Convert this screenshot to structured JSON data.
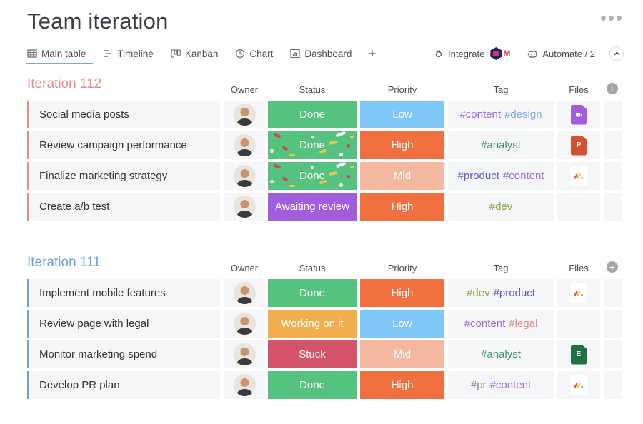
{
  "header": {
    "title": "Team iteration",
    "more_icon": "more-horizontal-icon"
  },
  "tabs": [
    {
      "label": "Main table",
      "icon": "table-icon",
      "active": true
    },
    {
      "label": "Timeline",
      "icon": "timeline-icon",
      "active": false
    },
    {
      "label": "Kanban",
      "icon": "kanban-icon",
      "active": false
    },
    {
      "label": "Chart",
      "icon": "chart-icon",
      "active": false
    },
    {
      "label": "Dashboard",
      "icon": "dashboard-icon",
      "active": false
    }
  ],
  "add_tab_label": "+",
  "toolbar": {
    "integrate_label": "Integrate",
    "automate_label": "Automate / 2",
    "collapse_icon": "chevron-up-icon"
  },
  "columns": {
    "owner": "Owner",
    "status": "Status",
    "priority": "Priority",
    "tag": "Tag",
    "files": "Files"
  },
  "colors": {
    "done": "#55c27f",
    "working": "#f2ad4e",
    "stuck": "#d5546a",
    "awaiting": "#a25ddc",
    "low": "#7ec8f8",
    "high": "#f0703f",
    "mid": "#f4b8a0",
    "group_112": "#e48a8a",
    "group_111": "#6fa0de",
    "tag_content": "#9b6ad6",
    "tag_design": "#7fa9e6",
    "tag_analyst": "#3f8f6a",
    "tag_product": "#5a5bc6",
    "tag_dev": "#8fa53c",
    "tag_legal": "#e38c8c",
    "tag_pr": "#8a8a94"
  },
  "groups": [
    {
      "title": "Iteration 112",
      "color": "#e48a8a",
      "rows": [
        {
          "name": "Social media posts",
          "status": "Done",
          "status_key": "done",
          "confetti": false,
          "priority": "Low",
          "priority_key": "low",
          "tags": [
            {
              "text": "#content",
              "key": "tag_content"
            },
            {
              "text": "#design",
              "key": "tag_design"
            }
          ],
          "file": "video-file"
        },
        {
          "name": "Review campaign performance",
          "status": "Done",
          "status_key": "done",
          "confetti": true,
          "priority": "High",
          "priority_key": "high",
          "tags": [
            {
              "text": "#analyst",
              "key": "tag_analyst"
            }
          ],
          "file": "powerpoint-file"
        },
        {
          "name": "Finalize marketing strategy",
          "status": "Done",
          "status_key": "done",
          "confetti": true,
          "priority": "Mid",
          "priority_key": "mid",
          "tags": [
            {
              "text": "#product",
              "key": "tag_product"
            },
            {
              "text": "#content",
              "key": "tag_content"
            }
          ],
          "file": "monday-file"
        },
        {
          "name": "Create a/b test",
          "status": "Awaiting review",
          "status_key": "awaiting",
          "confetti": false,
          "priority": "High",
          "priority_key": "high",
          "tags": [
            {
              "text": "#dev",
              "key": "tag_dev"
            }
          ],
          "file": ""
        }
      ]
    },
    {
      "title": "Iteration 111",
      "color": "#6fa0de",
      "rows": [
        {
          "name": "Implement mobile features",
          "status": "Done",
          "status_key": "done",
          "confetti": false,
          "priority": "High",
          "priority_key": "high",
          "tags": [
            {
              "text": "#dev",
              "key": "tag_dev"
            },
            {
              "text": "#product",
              "key": "tag_product"
            }
          ],
          "file": "monday-file"
        },
        {
          "name": "Review page with legal",
          "status": "Working on it",
          "status_key": "working",
          "confetti": false,
          "priority": "Low",
          "priority_key": "low",
          "tags": [
            {
              "text": "#content",
              "key": "tag_content"
            },
            {
              "text": "#legal",
              "key": "tag_legal"
            }
          ],
          "file": ""
        },
        {
          "name": "Monitor marketing spend",
          "status": "Stuck",
          "status_key": "stuck",
          "confetti": false,
          "priority": "Mid",
          "priority_key": "mid",
          "tags": [
            {
              "text": "#analyst",
              "key": "tag_analyst"
            }
          ],
          "file": "excel-file"
        },
        {
          "name": "Develop PR plan",
          "status": "Done",
          "status_key": "done",
          "confetti": false,
          "priority": "High",
          "priority_key": "high",
          "tags": [
            {
              "text": "#pr",
              "key": "tag_pr"
            },
            {
              "text": "#content",
              "key": "tag_content"
            }
          ],
          "file": "monday-file"
        }
      ]
    }
  ],
  "file_letters": {
    "powerpoint-file": "P",
    "excel-file": "E"
  }
}
